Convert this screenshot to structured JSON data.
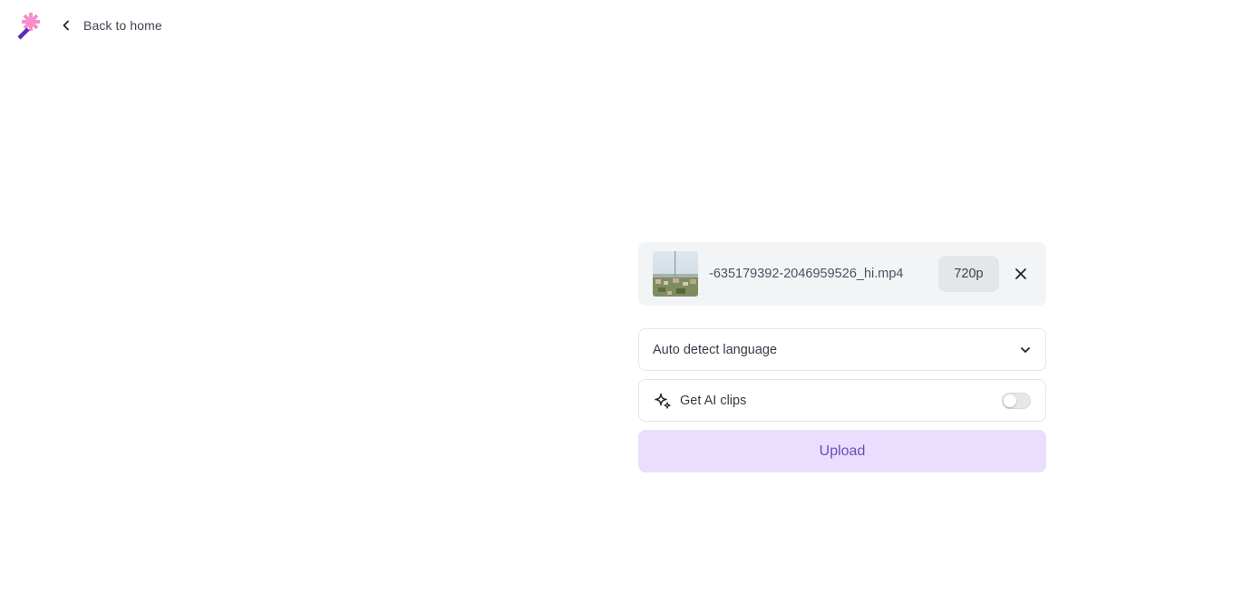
{
  "header": {
    "logo_icon": "sparkle-wand-logo",
    "back_label": "Back to home"
  },
  "upload": {
    "file": {
      "name": "-635179392-2046959526_hi.mp4",
      "resolution": "720p"
    },
    "language": {
      "selected": "Auto detect language"
    },
    "ai_clips": {
      "label": "Get AI clips",
      "enabled": false
    },
    "submit_label": "Upload"
  },
  "colors": {
    "accent_light": "#e9defd",
    "accent_text": "#6a4bb8",
    "logo_pink": "#f58ecb",
    "logo_purple": "#5b2bb8",
    "card_bg": "#f3f4f6"
  }
}
